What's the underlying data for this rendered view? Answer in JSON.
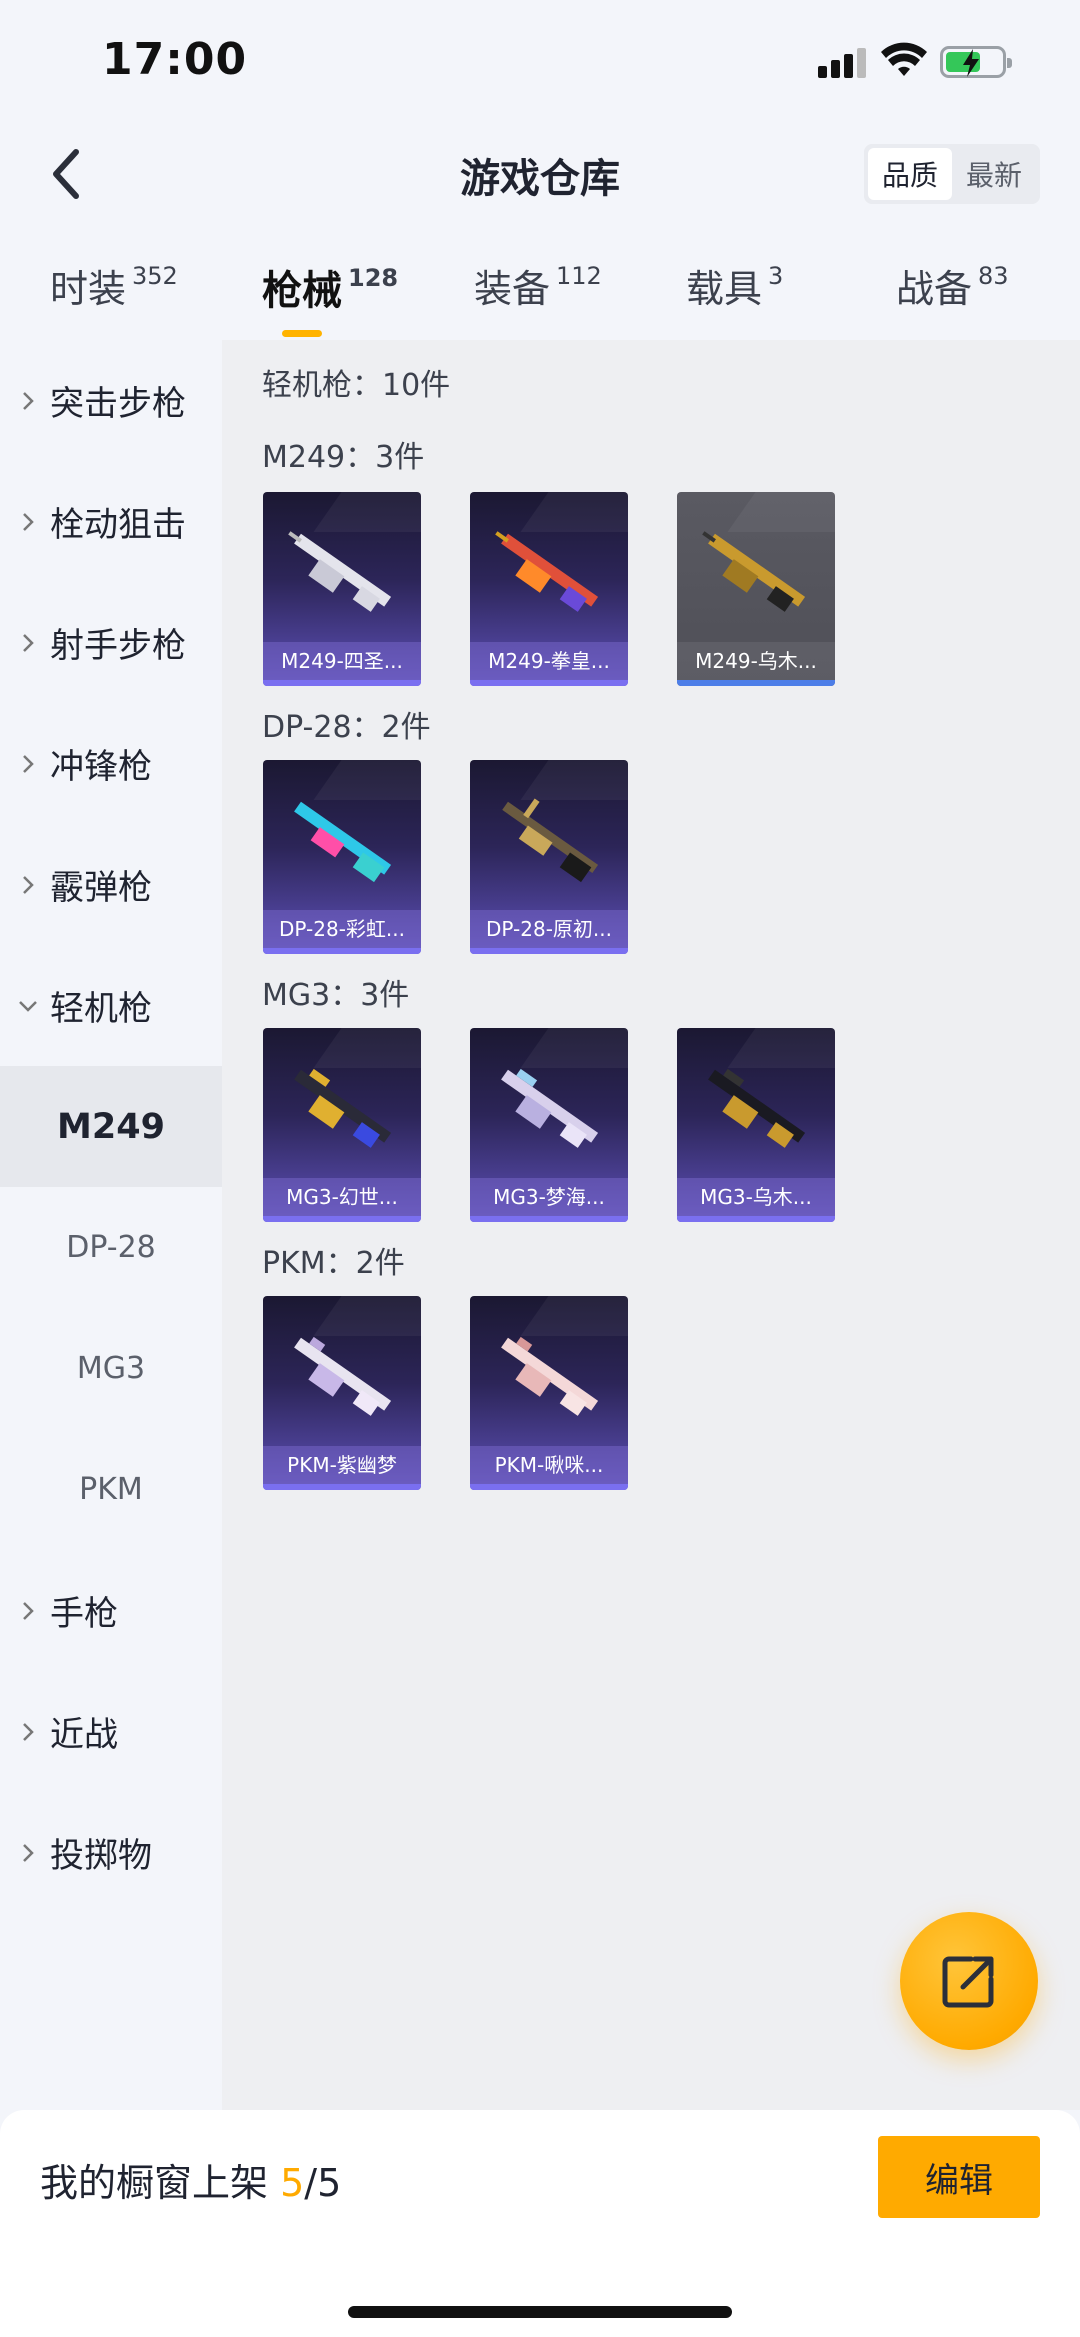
{
  "status": {
    "time": "17:00"
  },
  "header": {
    "title": "游戏仓库",
    "sort_options": [
      "品质",
      "最新"
    ],
    "sort_active": 0
  },
  "tabs": [
    {
      "label": "时装",
      "count": "352"
    },
    {
      "label": "枪械",
      "count": "128"
    },
    {
      "label": "装备",
      "count": "112"
    },
    {
      "label": "载具",
      "count": "3"
    },
    {
      "label": "战备",
      "count": "83"
    }
  ],
  "sidebar": {
    "categories": [
      "突击步枪",
      "栓动狙击",
      "射手步枪",
      "冲锋枪",
      "霰弹枪",
      "轻机枪"
    ],
    "subitems": [
      "M249",
      "DP-28",
      "MG3",
      "PKM"
    ],
    "categories_after": [
      "手枪",
      "近战",
      "投掷物"
    ]
  },
  "main": {
    "section_title": "轻机枪：10件",
    "groups": [
      {
        "title": "M249：3件",
        "items": [
          "M249-四圣...",
          "M249-拳皇...",
          "M249-乌木..."
        ]
      },
      {
        "title": "DP-28：2件",
        "items": [
          "DP-28-彩虹...",
          "DP-28-原初..."
        ]
      },
      {
        "title": "MG3：3件",
        "items": [
          "MG3-幻世...",
          "MG3-梦海...",
          "MG3-乌木..."
        ]
      },
      {
        "title": "PKM：2件",
        "items": [
          "PKM-紫幽梦",
          "PKM-啾咪..."
        ]
      }
    ]
  },
  "footer": {
    "showcase_label": "我的橱窗上架",
    "showcase_used": "5",
    "showcase_total": "/5",
    "edit_label": "编辑"
  },
  "colors": {
    "accent": "#ffaa00",
    "card_purple": "#4a3f92",
    "card_gray": "#55555d"
  }
}
